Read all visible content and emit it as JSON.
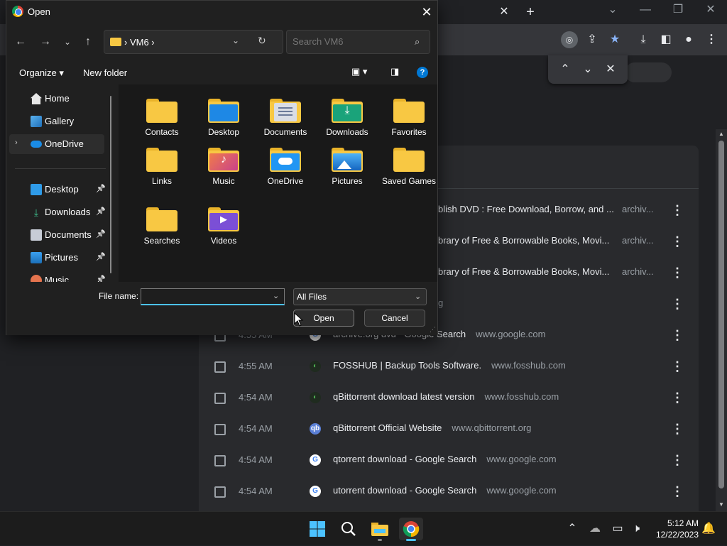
{
  "chrome": {
    "history_rows_partial": [
      {
        "title": "blish DVD : Free Download, Borrow, and ...",
        "domain": "archiv..."
      },
      {
        "title": "brary of Free & Borrowable Books, Movi...",
        "domain": "archiv..."
      },
      {
        "title": "brary of Free & Borrowable Books, Movi...",
        "domain": "archiv..."
      },
      {
        "title": "g",
        "domain": ""
      }
    ],
    "history_rows": [
      {
        "time": "4:55 AM",
        "title": "archive.org dvd - Google Search",
        "domain": "www.google.com",
        "favicon": "google"
      },
      {
        "time": "4:55 AM",
        "title": "FOSSHUB | Backup Tools Software.",
        "domain": "www.fosshub.com",
        "favicon": "fosshub"
      },
      {
        "time": "4:54 AM",
        "title": "qBittorrent download latest version",
        "domain": "www.fosshub.com",
        "favicon": "fosshub"
      },
      {
        "time": "4:54 AM",
        "title": "qBittorrent Official Website",
        "domain": "www.qbittorrent.org",
        "favicon": "qbittorrent"
      },
      {
        "time": "4:54 AM",
        "title": "qtorrent download - Google Search",
        "domain": "www.google.com",
        "favicon": "google"
      },
      {
        "time": "4:54 AM",
        "title": "utorrent download - Google Search",
        "domain": "www.google.com",
        "favicon": "google"
      }
    ]
  },
  "dialog": {
    "title": "Open",
    "address": {
      "path": "VM6"
    },
    "search": {
      "placeholder": "Search VM6"
    },
    "commands": {
      "organize": "Organize ▾",
      "new_folder": "New folder"
    },
    "sidebar": [
      {
        "label": "Home",
        "icon": "home-icon"
      },
      {
        "label": "Gallery",
        "icon": "gallery-icon"
      },
      {
        "label": "OneDrive",
        "icon": "onedrive-icon"
      },
      {
        "label": "Desktop",
        "icon": "desktop-icon"
      },
      {
        "label": "Downloads",
        "icon": "downloads-icon"
      },
      {
        "label": "Documents",
        "icon": "documents-icon"
      },
      {
        "label": "Pictures",
        "icon": "pictures-icon"
      },
      {
        "label": "Music",
        "icon": "music-icon"
      }
    ],
    "folders": [
      {
        "label": "Contacts",
        "type": "plain"
      },
      {
        "label": "Desktop",
        "type": "desktop"
      },
      {
        "label": "Documents",
        "type": "documents"
      },
      {
        "label": "Downloads",
        "type": "downloads"
      },
      {
        "label": "Favorites",
        "type": "plain"
      },
      {
        "label": "Links",
        "type": "plain"
      },
      {
        "label": "Music",
        "type": "music"
      },
      {
        "label": "OneDrive",
        "type": "onedrive"
      },
      {
        "label": "Pictures",
        "type": "pictures"
      },
      {
        "label": "Saved Games",
        "type": "plain"
      },
      {
        "label": "Searches",
        "type": "plain"
      },
      {
        "label": "Videos",
        "type": "videos"
      }
    ],
    "filename_label": "File name:",
    "filename_value": "",
    "filetype": "All Files",
    "open_label": "Open",
    "cancel_label": "Cancel"
  },
  "taskbar": {
    "time": "5:12 AM",
    "date": "12/22/2023"
  },
  "colors": {
    "accent": "#4cc2ff",
    "folder": "#f8c843",
    "chrome_star": "#8ab4f8"
  }
}
